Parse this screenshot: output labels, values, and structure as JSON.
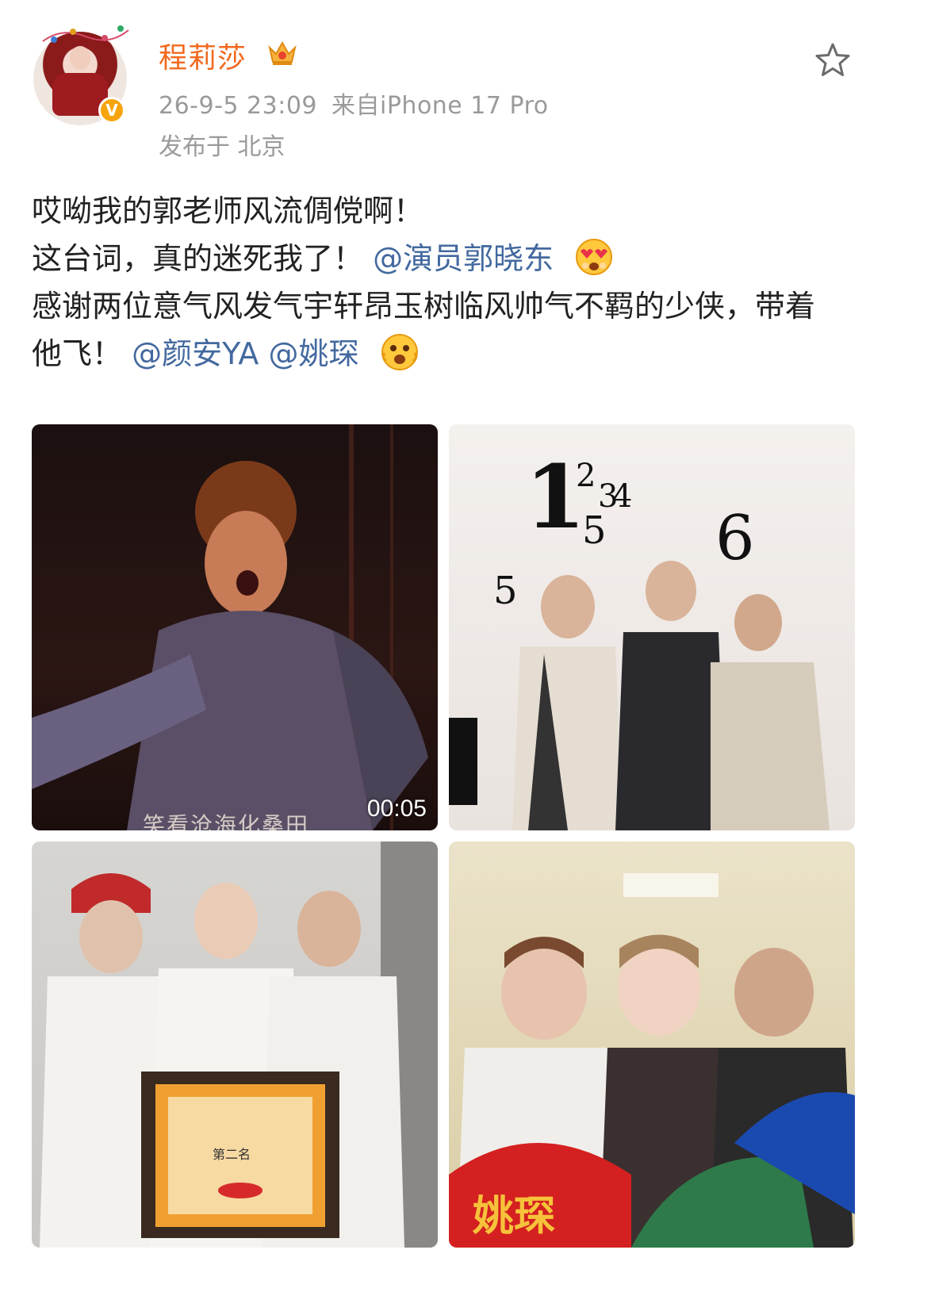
{
  "user": {
    "name": "程莉莎",
    "verified": true,
    "avatar_badge": "V",
    "crown_icon": "crown-icon"
  },
  "post_meta": {
    "time": "26-9-5 23:09",
    "source": "来自iPhone 17 Pro",
    "location": "发布于 北京"
  },
  "content": {
    "line1": "哎呦我的郭老师风流倜傥啊！",
    "line2_text": "这台词，真的迷死我了！",
    "line2_mention": "@演员郭晓东",
    "line3_text": "感谢两位意气风发气宇轩昂玉树临风帅气不羁的少侠，带着他飞！",
    "mention2": "@颜安YA",
    "mention3": "@姚琛"
  },
  "images": [
    {
      "kind": "video",
      "duration": "00:05",
      "subtitle": "笑看沧海化桑田"
    },
    {
      "kind": "photo",
      "overlay_numbers": [
        "1",
        "2",
        "3",
        "4",
        "5",
        "6",
        "5"
      ]
    },
    {
      "kind": "photo",
      "certificate_text": "第二名"
    },
    {
      "kind": "photo",
      "fan_text": "姚琛"
    }
  ],
  "colors": {
    "accent": "#f2691f",
    "mention": "#43699f",
    "meta": "#9a9a9a"
  }
}
